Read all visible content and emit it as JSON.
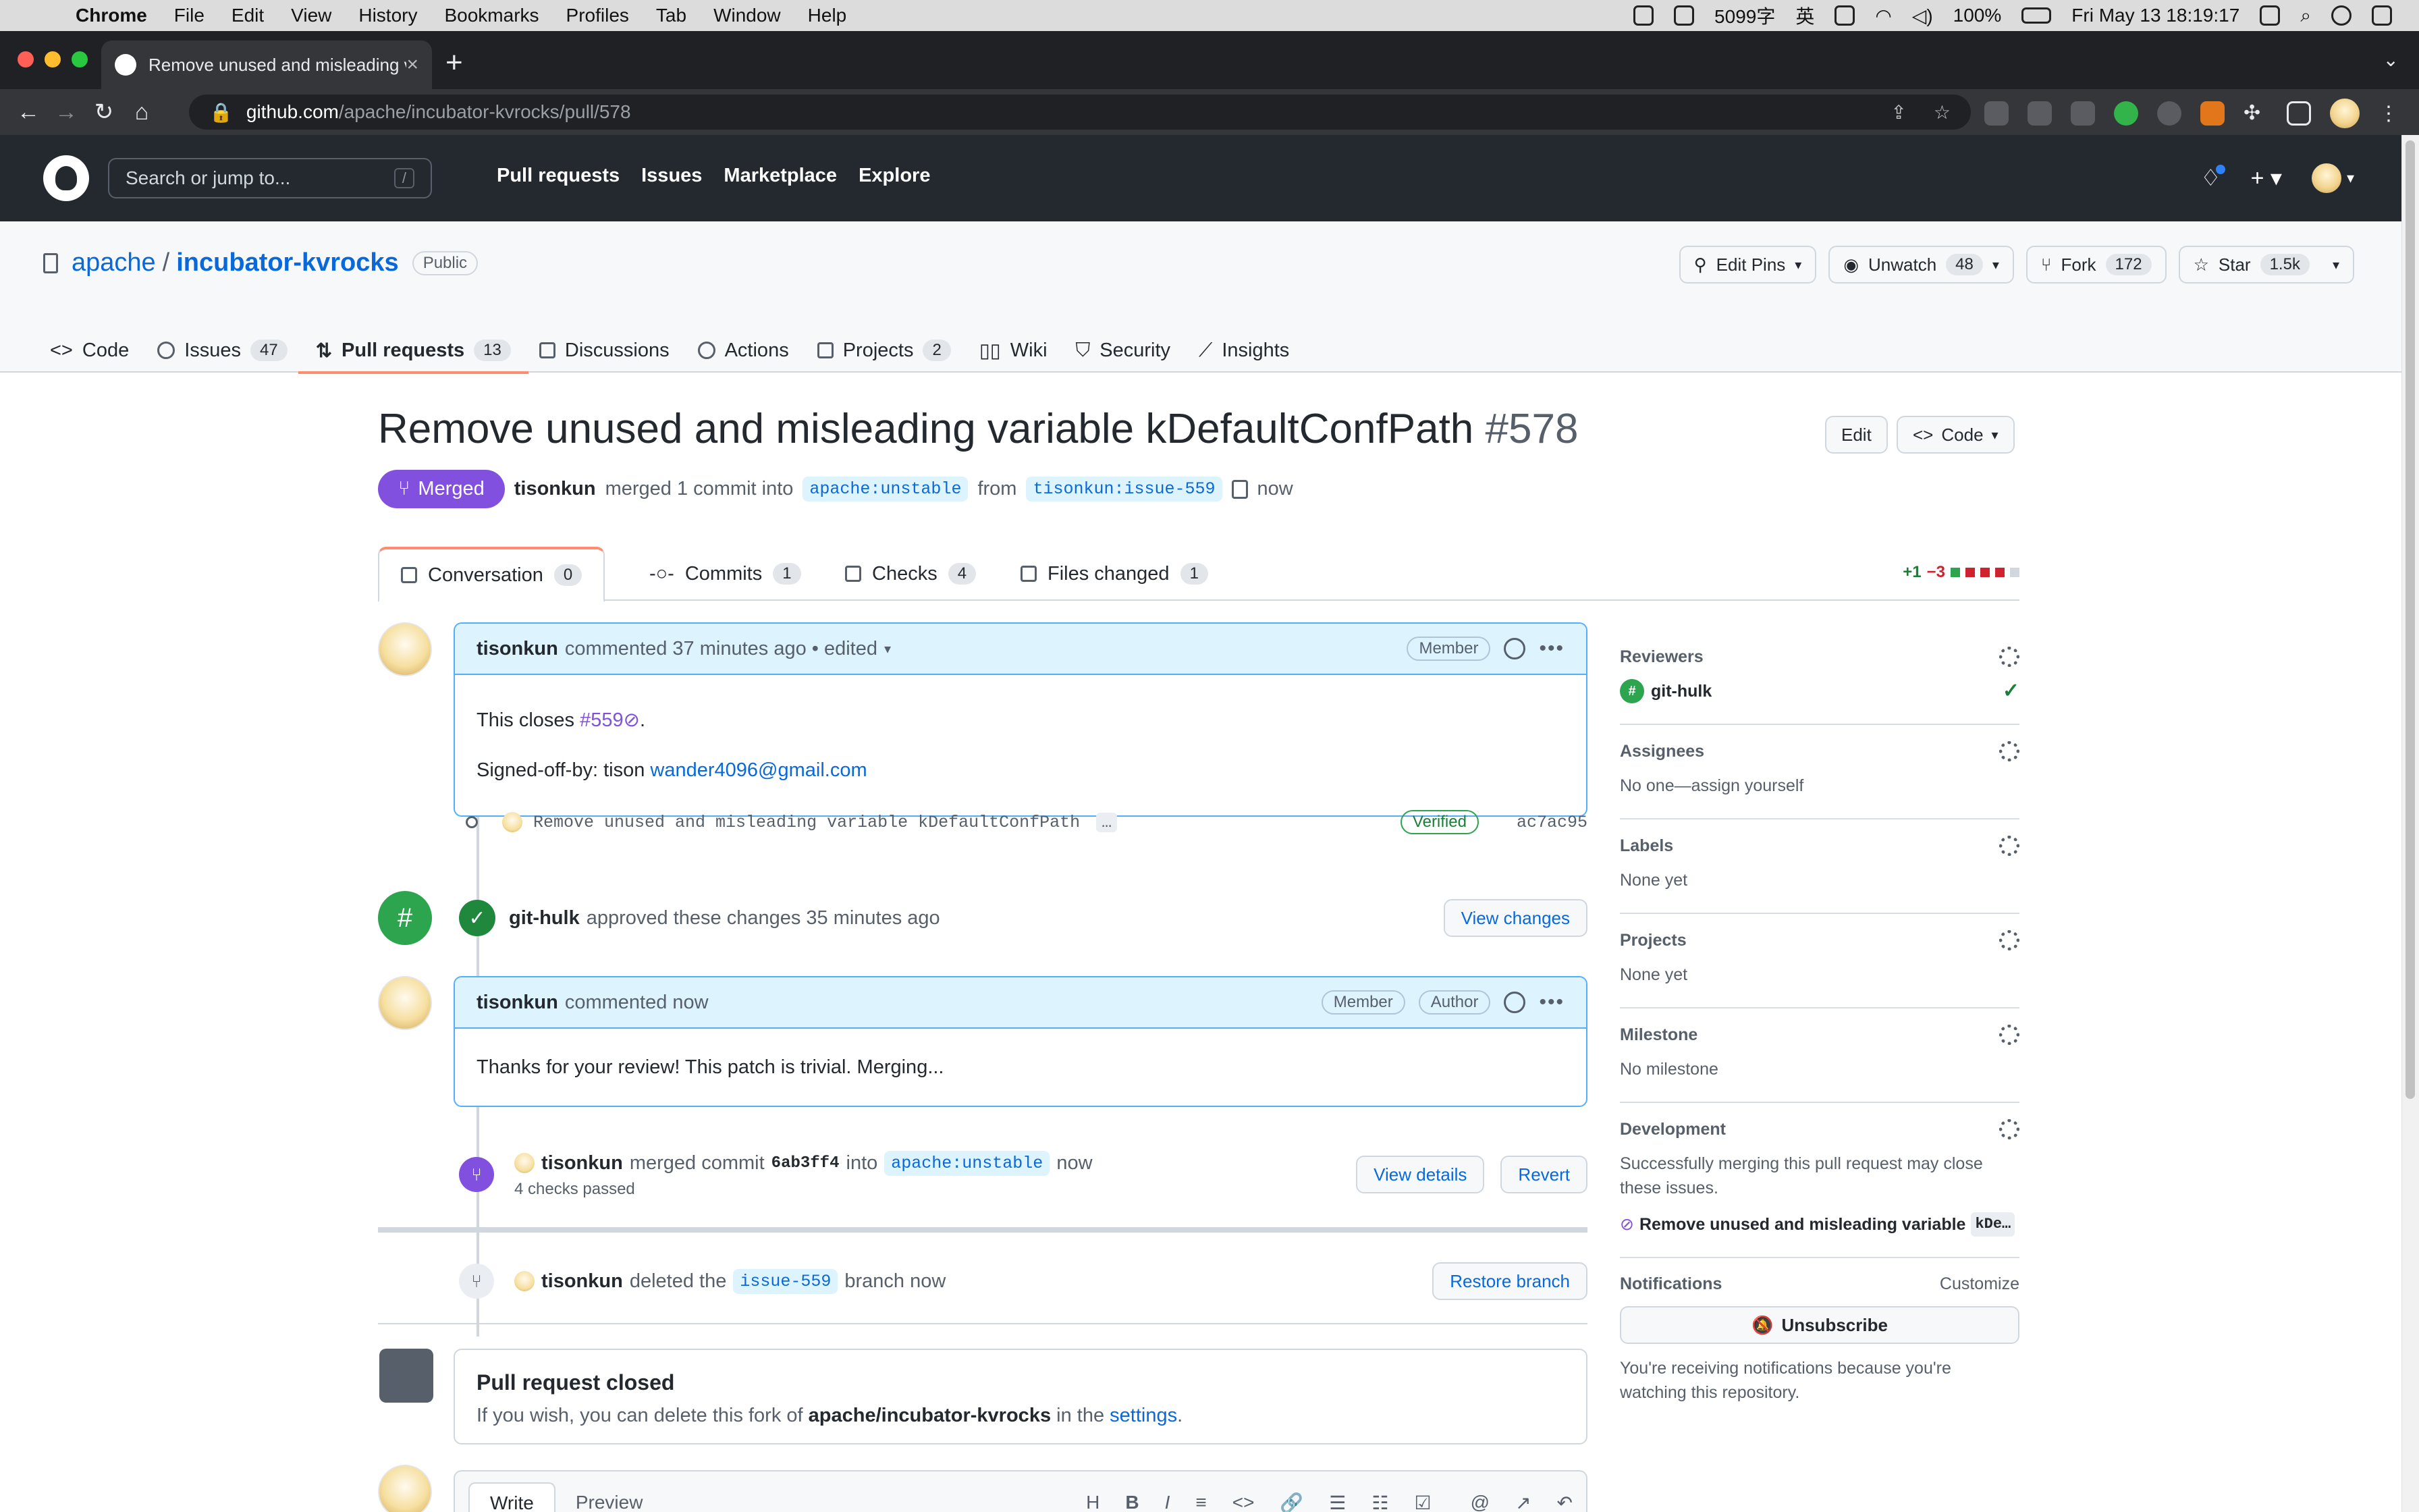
{
  "menubar": {
    "apple": "",
    "items": [
      "Chrome",
      "File",
      "Edit",
      "View",
      "History",
      "Bookmarks",
      "Profiles",
      "Tab",
      "Window",
      "Help"
    ],
    "status": {
      "chars": "5099字",
      "ime": "英",
      "battery": "100%",
      "datetime": "Fri May 13  18:19:17"
    }
  },
  "browser": {
    "tab_title": "Remove unused and misleading variable kDefaultConfPath",
    "tab_close": "×",
    "new_tab": "+",
    "url_host": "github.com",
    "url_path": "/apache/incubator-kvrocks/pull/578"
  },
  "github": {
    "search_placeholder": "Search or jump to...",
    "search_key": "/",
    "nav": [
      "Pull requests",
      "Issues",
      "Marketplace",
      "Explore"
    ]
  },
  "repo": {
    "owner": "apache",
    "separator": "/",
    "name": "incubator-kvrocks",
    "visibility": "Public",
    "actions": {
      "edit_pins": "Edit Pins",
      "unwatch": "Unwatch",
      "watch_count": "48",
      "fork": "Fork",
      "fork_count": "172",
      "star": "Star",
      "star_count": "1.5k"
    },
    "tabs": [
      {
        "label": "Code",
        "count": ""
      },
      {
        "label": "Issues",
        "count": "47"
      },
      {
        "label": "Pull requests",
        "count": "13"
      },
      {
        "label": "Discussions",
        "count": ""
      },
      {
        "label": "Actions",
        "count": ""
      },
      {
        "label": "Projects",
        "count": "2"
      },
      {
        "label": "Wiki",
        "count": ""
      },
      {
        "label": "Security",
        "count": ""
      },
      {
        "label": "Insights",
        "count": ""
      }
    ]
  },
  "pr": {
    "title": "Remove unused and misleading variable kDefaultConfPath",
    "number": "#578",
    "edit": "Edit",
    "code": "Code",
    "state": "Merged",
    "author": "tisonkun",
    "merge_text": "merged 1 commit into",
    "base": "apache:unstable",
    "from": "from",
    "head": "tisonkun:issue-559",
    "time": "now",
    "tabs": [
      {
        "label": "Conversation",
        "count": "0"
      },
      {
        "label": "Commits",
        "count": "1"
      },
      {
        "label": "Checks",
        "count": "4"
      },
      {
        "label": "Files changed",
        "count": "1"
      }
    ],
    "additions": "+1",
    "deletions": "−3"
  },
  "timeline": {
    "comment1": {
      "author": "tisonkun",
      "meta": "commented 37 minutes ago • edited",
      "badge": "Member",
      "line1_prefix": "This closes",
      "issue_ref": "#559",
      "line1_suffix": ".",
      "signoff": "Signed-off-by: tison",
      "email": "wander4096@gmail.com"
    },
    "commit": {
      "message": "Remove unused and misleading variable kDefaultConfPath",
      "more": "…",
      "verified": "Verified",
      "sha": "ac7ac95"
    },
    "approval": {
      "user": "git-hulk",
      "text": "approved these changes 35 minutes ago",
      "button": "View changes"
    },
    "comment2": {
      "author": "tisonkun",
      "meta": "commented now",
      "badge1": "Member",
      "badge2": "Author",
      "body": "Thanks for your review! This patch is trivial. Merging..."
    },
    "merge": {
      "user": "tisonkun",
      "text": "merged commit",
      "sha": "6ab3ff4",
      "into": "into",
      "branch": "apache:unstable",
      "time": "now",
      "checks": "4 checks passed",
      "details": "View details",
      "revert": "Revert"
    },
    "deleted": {
      "user": "tisonkun",
      "text": "deleted the",
      "branch": "issue-559",
      "suffix": "branch now",
      "button": "Restore branch"
    },
    "closed": {
      "title": "Pull request closed",
      "line_prefix": "If you wish, you can delete this fork of",
      "repo": "apache/incubator-kvrocks",
      "line_mid": "in the",
      "settings": "settings",
      "line_end": "."
    },
    "editor": {
      "write": "Write",
      "preview": "Preview",
      "tools": [
        "H",
        "B",
        "I",
        "≡",
        "<>",
        "🔗",
        "☰",
        "☷",
        "☑",
        "@",
        "↗",
        "↶"
      ]
    }
  },
  "sidebar": {
    "reviewers": {
      "title": "Reviewers",
      "name": "git-hulk"
    },
    "assignees": {
      "title": "Assignees",
      "value": "No one—assign yourself"
    },
    "labels": {
      "title": "Labels",
      "value": "None yet"
    },
    "projects": {
      "title": "Projects",
      "value": "None yet"
    },
    "milestone": {
      "title": "Milestone",
      "value": "No milestone"
    },
    "development": {
      "title": "Development",
      "value": "Successfully merging this pull request may close these issues.",
      "issue": "Remove unused and misleading variable",
      "issue_code": "kDe…"
    },
    "notifications": {
      "title": "Notifications",
      "customize": "Customize",
      "button": "Unsubscribe",
      "value": "You're receiving notifications because you're watching this repository."
    }
  },
  "colors": {
    "merged": "#8250df",
    "link": "#0969da",
    "success": "#1a7f37",
    "danger": "#cf222e",
    "header": "#24292f"
  }
}
